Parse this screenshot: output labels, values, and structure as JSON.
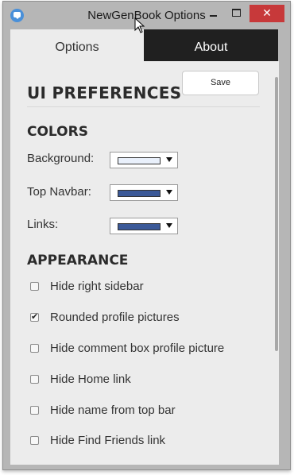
{
  "window": {
    "title": "NewGenBook Options",
    "close_glyph": "✕"
  },
  "tabs": [
    {
      "label": "Options",
      "active": true
    },
    {
      "label": "About",
      "active": false
    }
  ],
  "toolbar": {
    "save_label": "Save"
  },
  "ui_preferences": {
    "heading": "UI PREFERENCES"
  },
  "colors": {
    "heading": "COLORS",
    "fields": [
      {
        "label": "Background:",
        "value": "#e9f0fb"
      },
      {
        "label": "Top Navbar:",
        "value": "#3b5998"
      },
      {
        "label": "Links:",
        "value": "#3b5998"
      }
    ]
  },
  "appearance": {
    "heading": "APPEARANCE",
    "options": [
      {
        "label": "Hide right sidebar",
        "checked": false
      },
      {
        "label": "Rounded profile pictures",
        "checked": true
      },
      {
        "label": "Hide comment box profile picture",
        "checked": false
      },
      {
        "label": "Hide Home link",
        "checked": false
      },
      {
        "label": "Hide name from top bar",
        "checked": false
      },
      {
        "label": "Hide Find Friends link",
        "checked": false
      }
    ]
  },
  "theme": {
    "titlebar_color": "#b6b6b6",
    "close_color": "#c7393a",
    "tabbar_color": "#202020",
    "panel_color": "#ececec"
  }
}
